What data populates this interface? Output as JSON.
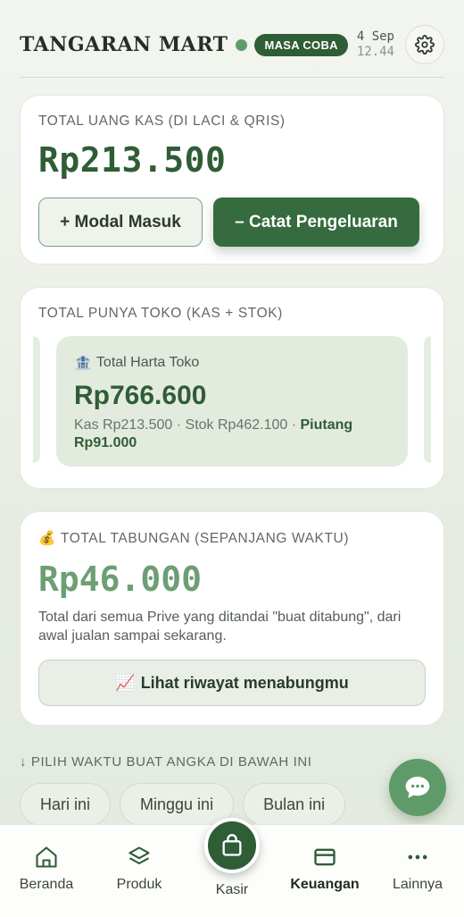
{
  "header": {
    "brand": "TANGARAN MART",
    "trial_badge": "MASA COBA",
    "date": "4 Sep",
    "time": "12.44",
    "settings_icon": "gear-icon"
  },
  "cash_card": {
    "label": "TOTAL UANG KAS (DI LACI & QRIS)",
    "amount": "Rp213.500",
    "add_capital_label": "+ Modal Masuk",
    "record_expense_label": "– Catat Pengeluaran"
  },
  "store_card": {
    "label": "TOTAL PUNYA TOKO (KAS + STOK)",
    "asset_icon": "🏦",
    "asset_title": "Total Harta Toko",
    "asset_amount": "Rp766.600",
    "asset_detail_plain": "Kas Rp213.500 · Stok Rp462.100 · ",
    "asset_detail_bold": "Piutang Rp91.000"
  },
  "savings_card": {
    "icon": "💰",
    "label": "TOTAL TABUNGAN (SEPANJANG WAKTU)",
    "amount": "Rp46.000",
    "note": "Total dari semua Prive yang ditandai \"buat ditabung\", dari awal jualan sampai sekarang.",
    "history_icon": "📈",
    "history_label": "Lihat riwayat menabungmu"
  },
  "period": {
    "label": "↓ PILIH WAKTU BUAT ANGKA DI BAWAH INI",
    "tabs": [
      "Hari ini",
      "Minggu ini",
      "Bulan ini"
    ]
  },
  "bottom_nav": {
    "items": [
      {
        "label": "Beranda",
        "icon": "home-icon"
      },
      {
        "label": "Produk",
        "icon": "layers-icon"
      },
      {
        "label": "Kasir",
        "icon": "shopping-bag-icon"
      },
      {
        "label": "Keuangan",
        "icon": "wallet-icon"
      },
      {
        "label": "Lainnya",
        "icon": "more-icon"
      }
    ],
    "active": "Keuangan"
  },
  "colors": {
    "primary": "#2f5d36",
    "accent": "#5f9b68",
    "savings": "#6d9e74"
  }
}
